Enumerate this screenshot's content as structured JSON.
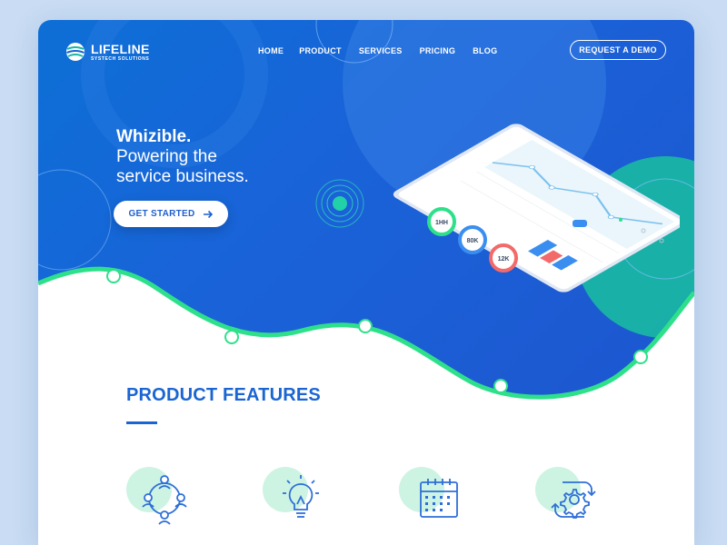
{
  "brand": {
    "name": "LIFELINE",
    "tagline": "SYSTECH SOLUTIONS"
  },
  "nav": {
    "items": [
      "HOME",
      "PRODUCT",
      "SERVICES",
      "PRICING",
      "BLOG"
    ],
    "demo_button": "REQUEST A DEMO"
  },
  "hero": {
    "brand_line": "Whizible.",
    "tagline_line1": "Powering the",
    "tagline_line2": "service business.",
    "cta_label": "GET STARTED"
  },
  "dashboard": {
    "gauges": [
      "1HH",
      "80K",
      "12K"
    ]
  },
  "features": {
    "title": "PRODUCT FEATURES",
    "icons": [
      "team-icon",
      "lightbulb-icon",
      "calendar-icon",
      "gear-cycle-icon"
    ]
  },
  "colors": {
    "primary": "#1a62d8",
    "accent_green": "#2ee08a",
    "teal": "#19b9a3",
    "title_blue": "#1a65d3"
  }
}
